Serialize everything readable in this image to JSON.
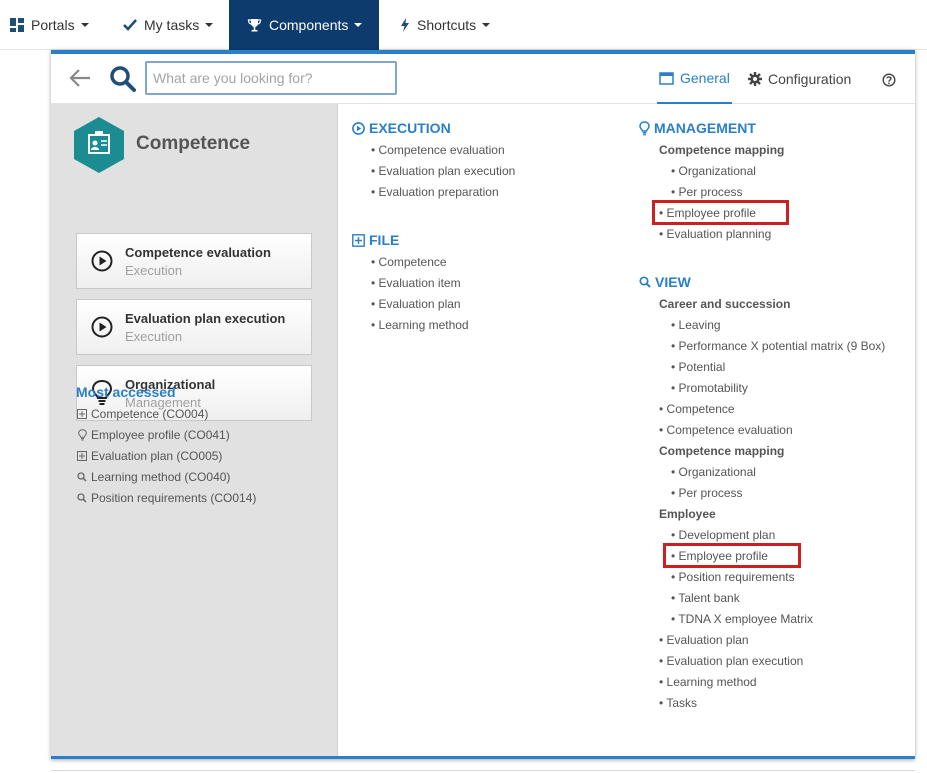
{
  "nav": {
    "items": [
      {
        "label": "Portals",
        "icon": "grid-icon"
      },
      {
        "label": "My tasks",
        "icon": "check-icon"
      },
      {
        "label": "Components",
        "icon": "trophy-icon",
        "active": true
      },
      {
        "label": "Shortcuts",
        "icon": "bolt-icon"
      }
    ]
  },
  "header": {
    "search_placeholder": "What are you looking for?",
    "tab_general": "General",
    "tab_configuration": "Configuration"
  },
  "left": {
    "title": "Competence",
    "cards": [
      {
        "title": "Competence evaluation",
        "subtitle": "Execution",
        "icon": "play-circle-icon"
      },
      {
        "title": "Evaluation plan execution",
        "subtitle": "Execution",
        "icon": "play-circle-icon"
      },
      {
        "title": "Organizational",
        "subtitle": "Management",
        "icon": "lightbulb-icon"
      }
    ],
    "most_accessed_title": "Most accessed",
    "most_accessed": [
      {
        "label": "Competence (CO004)",
        "icon": "plus-square-icon"
      },
      {
        "label": "Employee profile (CO041)",
        "icon": "lightbulb-icon"
      },
      {
        "label": "Evaluation plan (CO005)",
        "icon": "plus-square-icon"
      },
      {
        "label": "Learning method (CO040)",
        "icon": "search-icon"
      },
      {
        "label": "Position requirements (CO014)",
        "icon": "search-icon"
      }
    ]
  },
  "execution": {
    "title": "EXECUTION",
    "items": [
      "• Competence evaluation",
      "• Evaluation plan execution",
      "• Evaluation preparation"
    ]
  },
  "file": {
    "title": "FILE",
    "items": [
      "• Competence",
      "• Evaluation item",
      "• Evaluation plan",
      "• Learning method"
    ]
  },
  "management": {
    "title": "MANAGEMENT",
    "group": "Competence mapping",
    "items": [
      "• Organizational",
      "• Per process",
      "• Employee profile",
      "• Evaluation planning"
    ]
  },
  "view": {
    "title": "VIEW",
    "items": [
      "Career and succession",
      "• Leaving",
      "• Performance X potential matrix (9 Box)",
      "• Potential",
      "• Promotability",
      "• Competence",
      "• Competence evaluation",
      "Competence mapping",
      "• Organizational",
      "• Per process",
      "Employee",
      "• Development plan",
      "• Employee profile",
      "• Position requirements",
      "• Talent bank",
      "• TDNA X employee Matrix",
      "• Evaluation plan",
      "• Evaluation plan execution",
      "• Learning method",
      "• Tasks"
    ]
  },
  "colors": {
    "accent": "#2a7fc9",
    "nav_active": "#0d3b6e",
    "highlight": "#cc1f1f",
    "hex": "#1c8c93"
  }
}
